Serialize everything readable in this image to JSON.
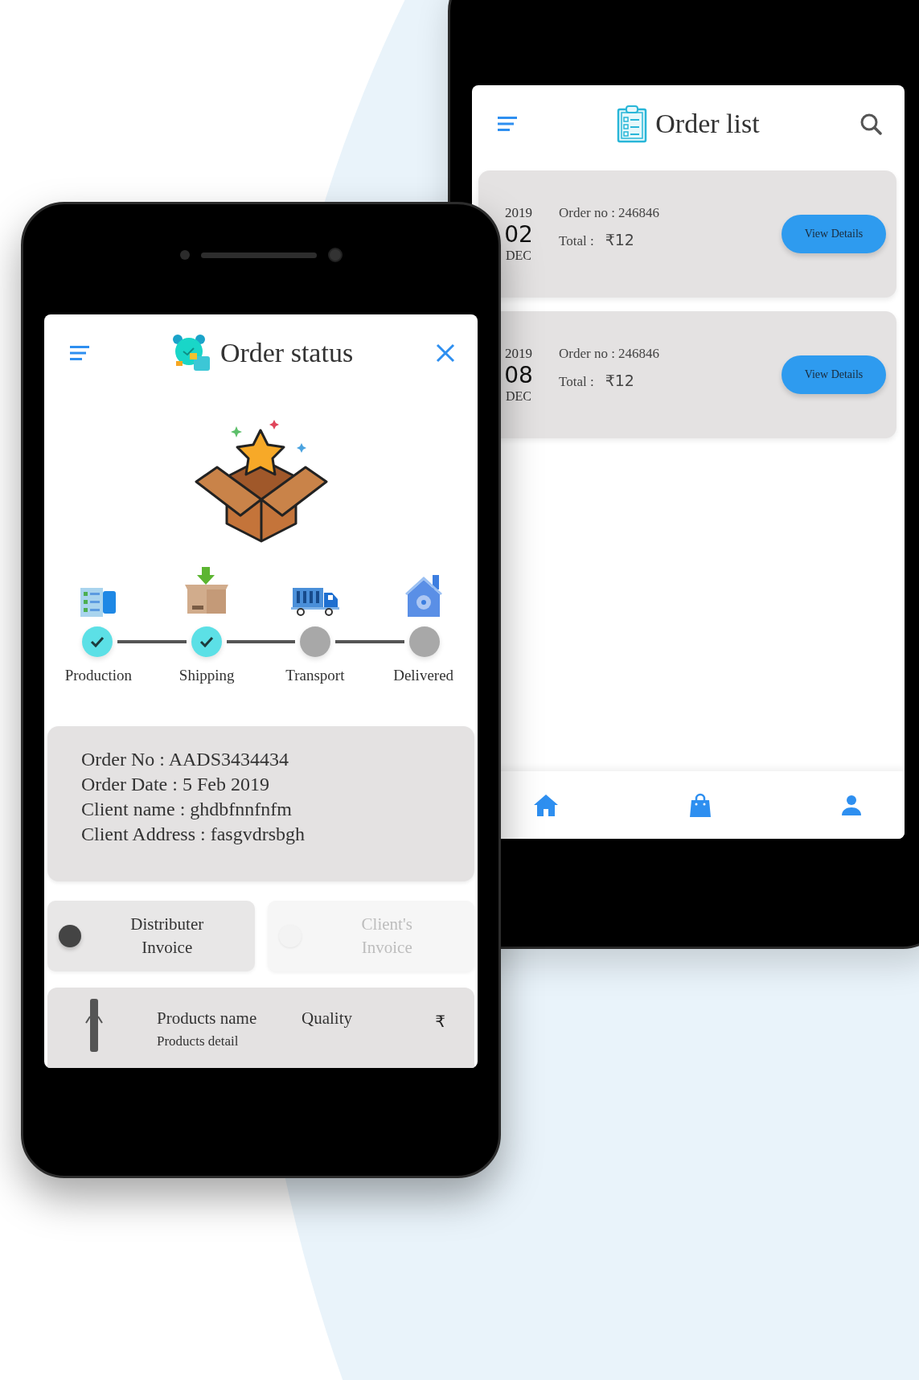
{
  "order_status_screen": {
    "title": "Order status",
    "steps": [
      {
        "kind": "production",
        "label": "Production",
        "done": true
      },
      {
        "kind": "shipping",
        "label": "Shipping",
        "done": true
      },
      {
        "kind": "transport",
        "label": "Transport",
        "done": false
      },
      {
        "kind": "delivered",
        "label": "Delivered",
        "done": false
      }
    ],
    "details": [
      "Order No : AADS3434434",
      "Order Date : 5 Feb 2019",
      "Client name : ghdbfnnfnfm",
      "Client Address : fasgvdrsbgh"
    ],
    "invoice_options": [
      {
        "label": "Distributer Invoice",
        "selected": true
      },
      {
        "label": "Client's Invoice",
        "selected": false
      }
    ],
    "product_row": {
      "name": "Products name",
      "detail": "Products detail",
      "quality": "Quality",
      "price": "₹"
    }
  },
  "order_list_screen": {
    "title": "Order list",
    "orders": [
      {
        "year": "2019",
        "day": "02",
        "month": "DEC",
        "order_no": "Order no : 246846",
        "total_label": "Total :",
        "total": "₹12",
        "button": "View Details"
      },
      {
        "year": "2019",
        "day": "08",
        "month": "DEC",
        "order_no": "Order no : 246846",
        "total_label": "Total :",
        "total": "₹12",
        "button": "View Details"
      }
    ]
  }
}
